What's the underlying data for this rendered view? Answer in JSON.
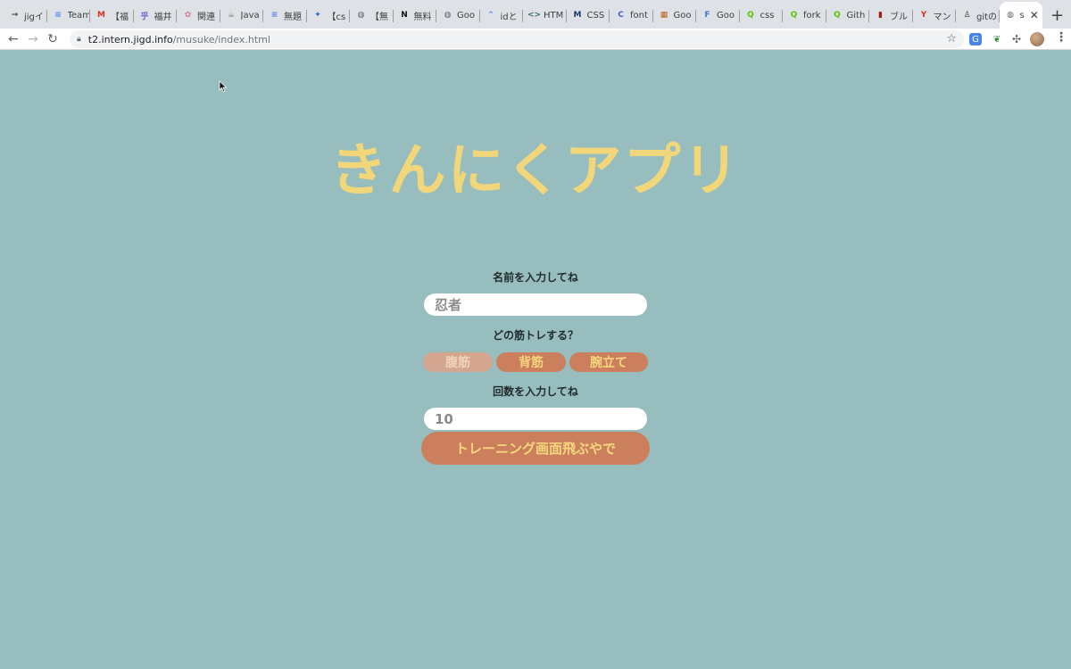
{
  "browser": {
    "tabs": [
      {
        "title": "jigイ",
        "icon": "arrow-icon",
        "fav": "→",
        "color": "#444444"
      },
      {
        "title": "Team",
        "icon": "docs-icon",
        "fav": "≡",
        "color": "#4a86e8"
      },
      {
        "title": "【福",
        "icon": "gmail-icon",
        "fav": "M",
        "color": "#d93025"
      },
      {
        "title": "福井",
        "icon": "kanji-icon",
        "fav": "乎",
        "color": "#6a5acd"
      },
      {
        "title": "関連",
        "icon": "flower-icon",
        "fav": "✿",
        "color": "#e57399"
      },
      {
        "title": "Java",
        "icon": "java-icon",
        "fav": "☕",
        "color": "#7a7a7a"
      },
      {
        "title": "無題",
        "icon": "docs-icon",
        "fav": "≡",
        "color": "#4a86e8"
      },
      {
        "title": "【cs",
        "icon": "sparkle-icon",
        "fav": "✦",
        "color": "#3367d6"
      },
      {
        "title": "【無",
        "icon": "globe-icon",
        "fav": "◍",
        "color": "#5f6368"
      },
      {
        "title": "無料",
        "icon": "notion-icon",
        "fav": "N",
        "color": "#111111"
      },
      {
        "title": "Goo",
        "icon": "globe-icon",
        "fav": "◍",
        "color": "#5f6368"
      },
      {
        "title": "idと",
        "icon": "chevron-up-icon",
        "fav": "⌃",
        "color": "#3b82f6"
      },
      {
        "title": "HTM",
        "icon": "code-icon",
        "fav": "<>",
        "color": "#3c6e71"
      },
      {
        "title": "CSS",
        "icon": "m-icon",
        "fav": "M",
        "color": "#1a3a6b"
      },
      {
        "title": "font",
        "icon": "c-icon",
        "fav": "C",
        "color": "#4a5cd6"
      },
      {
        "title": "Goo",
        "icon": "image-icon",
        "fav": "▦",
        "color": "#b5651d"
      },
      {
        "title": "Goo",
        "icon": "f-icon",
        "fav": "F",
        "color": "#4b6fd6"
      },
      {
        "title": "css",
        "icon": "q-icon",
        "fav": "Q",
        "color": "#55c500"
      },
      {
        "title": "fork",
        "icon": "q-icon",
        "fav": "Q",
        "color": "#55c500"
      },
      {
        "title": "Gith",
        "icon": "q-icon",
        "fav": "Q",
        "color": "#55c500"
      },
      {
        "title": "ブル",
        "icon": "book-icon",
        "fav": "▮",
        "color": "#a02020"
      },
      {
        "title": "マン",
        "icon": "yt-icon",
        "fav": "Y",
        "color": "#d93025"
      },
      {
        "title": "gitの",
        "icon": "person-icon",
        "fav": "♙",
        "color": "#333333"
      },
      {
        "title": "s",
        "icon": "globe-icon",
        "fav": "◍",
        "color": "#5f6368",
        "active": true
      }
    ],
    "new_tab": "+",
    "url_host": "t2.intern.jigd.info",
    "url_path": "/musuke/index.html"
  },
  "app": {
    "title": "きんにくアプリ",
    "name_label": "名前を入力してね",
    "name_placeholder": "忍者",
    "exercise_label": "どの筋トレする？",
    "exercises": [
      {
        "label": "腹筋",
        "selected": false
      },
      {
        "label": "背筋",
        "selected": true
      },
      {
        "label": "腕立て",
        "selected": true
      }
    ],
    "count_label": "回数を入力してね",
    "count_value": "10",
    "submit_label": "トレーニング画面飛ぶやで"
  },
  "colors": {
    "background": "#98bdbf",
    "title": "#f2d67a",
    "button": "#cc7f5d",
    "button_text": "#f5d77e",
    "chip_off": "#d4a690"
  }
}
